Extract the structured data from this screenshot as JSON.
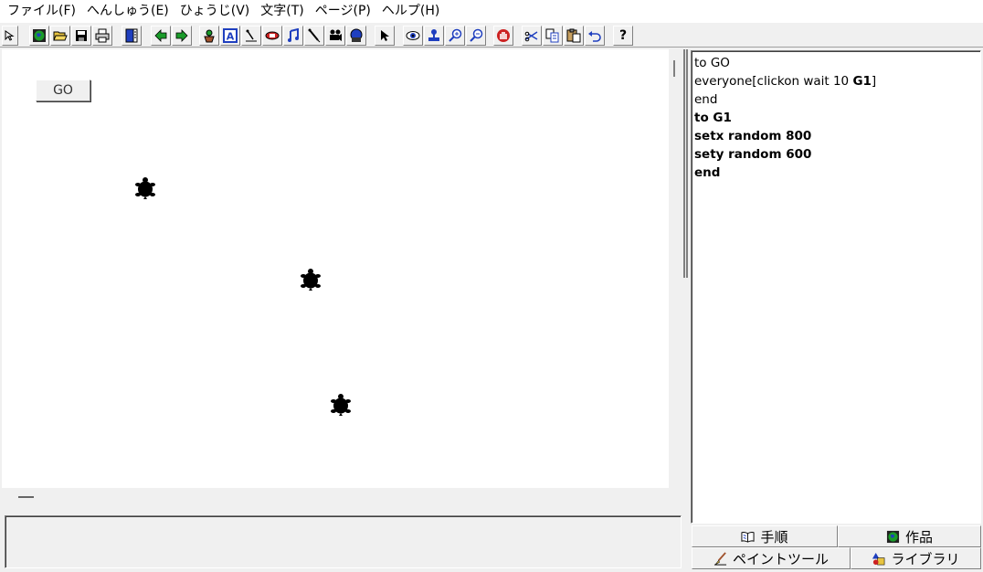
{
  "menubar": {
    "items": [
      "ファイル(F)",
      "へんしゅう(E)",
      "ひょうじ(V)",
      "文字(T)",
      "ページ(P)",
      "ヘルプ(H)"
    ]
  },
  "toolbar": {
    "tools": [
      "select-arrow",
      "globe",
      "open-folder",
      "save-disk",
      "printer",
      "pages",
      "previous-page",
      "next-page",
      "new-turtle",
      "text-box",
      "slider",
      "shape",
      "music",
      "pen",
      "video",
      "record",
      "pointer",
      "eye",
      "stamp",
      "zoom-in",
      "zoom-out",
      "stop-hand",
      "scissors",
      "copy",
      "paste",
      "undo",
      "help"
    ],
    "help_label": "?"
  },
  "stage": {
    "go_button_label": "GO",
    "turtle_count": 3
  },
  "procedures": {
    "lines": [
      {
        "text": "to GO",
        "bold": false
      },
      {
        "text": "everyone[clickon wait 10 G1]",
        "bold": false
      },
      {
        "text": "end",
        "bold": false
      },
      {
        "text": "to G1",
        "bold": true
      },
      {
        "text": "setx random 800",
        "bold": true
      },
      {
        "text": "sety random 600",
        "bold": true
      },
      {
        "text": "end",
        "bold": true
      }
    ]
  },
  "tabs": {
    "procedures_label": "手順",
    "project_label": "作品",
    "paint_label": "ペイントツール",
    "library_label": "ライブラリ"
  },
  "colors": {
    "accent_green": "#1a9b2a",
    "accent_blue": "#1f3fbf",
    "stop_red": "#cc2222"
  }
}
